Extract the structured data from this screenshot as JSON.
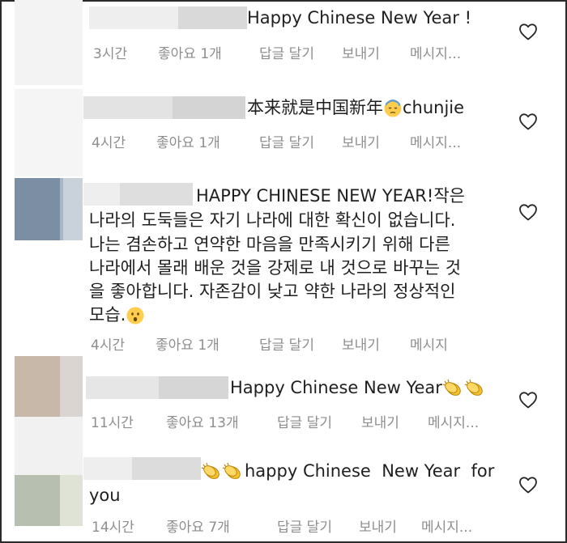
{
  "colors": {
    "text": "#1f1f1f",
    "meta": "#8e8e8e",
    "border": "#2b2b2b",
    "blur_light": "#eeeeee",
    "blur_mid": "#dcdcdc",
    "avatar_blue": "#7b8ea3",
    "avatar_tan": "#c8b8aa",
    "avatar_green": "#b7c0b0"
  },
  "comments": [
    {
      "text": "Happy Chinese New Year !",
      "time": "3시간",
      "likes": "좋아요 1개",
      "reply": "답글 달기",
      "send": "보내기",
      "message": "메시지..."
    },
    {
      "text_before": "本来就是中国新年",
      "emoji_name": "sad-sweat-face-icon",
      "text_after": "chunjie",
      "time": "4시간",
      "likes": "좋아요 1개",
      "reply": "답글 달기",
      "send": "보내기",
      "message": "메시지..."
    },
    {
      "line1": "HAPPY CHINESE NEW YEAR!작은",
      "line2": "나라의 도둑들은 자기 나라에 대한 확신이 없습니다.",
      "line3": "나는 겸손하고 연약한 마음을 만족시키기 위해 다른",
      "line4": "나라에서 몰래 배운 것을 강제로 내 것으로 바꾸는 것",
      "line5": "을 좋아합니다. 자존감이 낮고 약한 나라의 정상적인",
      "line6": "모습.",
      "emoji_name": "hushed-face-icon",
      "time": "4시간",
      "likes": "좋아요 1개",
      "reply": "답글 달기",
      "send": "보내기",
      "message": "메시지"
    },
    {
      "text": "Happy Chinese New Year",
      "emoji_name": "clapping-hands-icon",
      "time": "11시간",
      "likes": "좋아요 13개",
      "reply": "답글 달기",
      "send": "보내기",
      "message": "메시지..."
    },
    {
      "emoji_name": "clapping-hands-icon",
      "line1": "happy Chinese  New Year  for",
      "line2": "you",
      "time": "14시간",
      "likes": "좋아요 7개",
      "reply": "답글 달기",
      "send": "보내기",
      "message": "메시지..."
    }
  ]
}
